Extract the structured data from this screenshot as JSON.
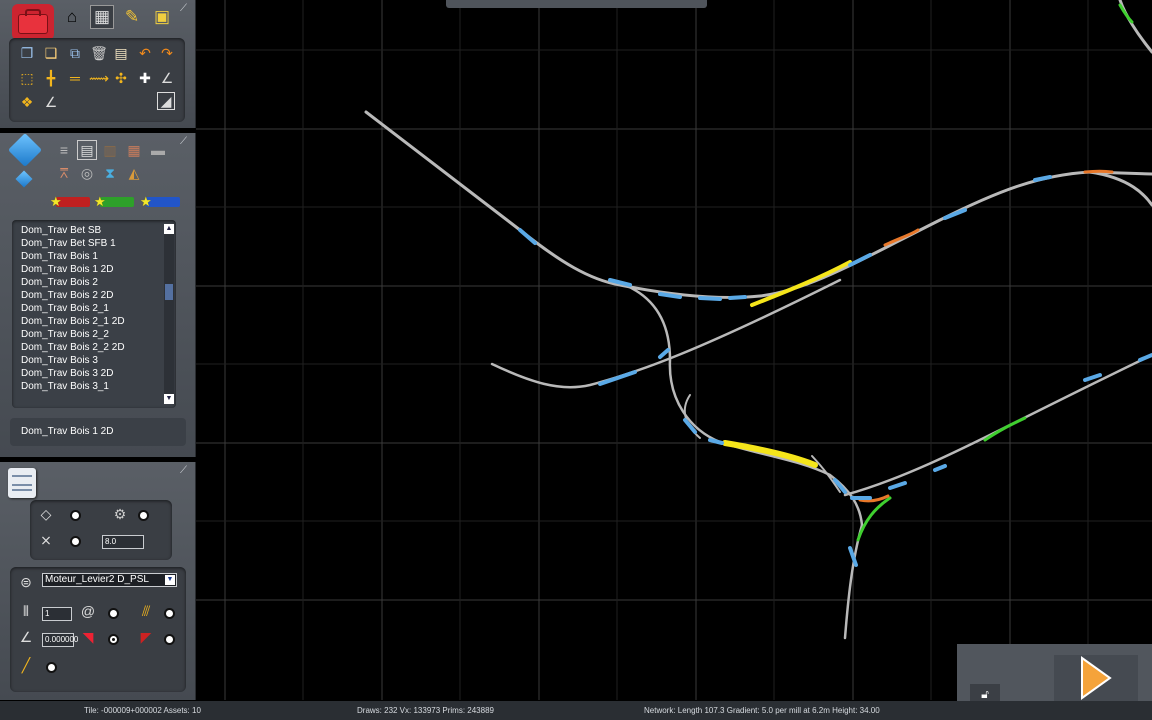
{
  "top_toolbar": {
    "icons": [
      "toolbox-icon",
      "home-icon",
      "track-grid-icon",
      "paint-brush-icon",
      "train-icon"
    ]
  },
  "tools_panel": {
    "icons": [
      "copy-icon",
      "paste-icon",
      "paste-region-icon",
      "delete-icon",
      "clone-icon",
      "undo-icon",
      "redo-icon",
      "select-region-icon",
      "join-icon",
      "split-icon",
      "track-stretch-icon",
      "fine-adjust-icon",
      "crosshair-icon",
      "angle-icon",
      "bundle-icon",
      "angle-small-icon",
      "brush-size-icon"
    ]
  },
  "asset_panel": {
    "icons": [
      "asset-cube-icon",
      "asset-cube-small-icon",
      "track-type-1-icon",
      "track-type-2-icon",
      "track-type-3-icon",
      "track-type-4-icon",
      "track-type-5-icon",
      "bridge-icon",
      "tunnel-icon",
      "junction-icon",
      "splitter-icon"
    ],
    "star_bars": [
      {
        "color": "#c02020"
      },
      {
        "color": "#2ea02a"
      },
      {
        "color": "#2255c8"
      }
    ],
    "list_items": [
      "Dom_Trav Bet SB",
      "Dom_Trav Bet SFB 1",
      "Dom_Trav Bois 1",
      "Dom_Trav Bois 1 2D",
      "Dom_Trav Bois 2",
      "Dom_Trav Bois 2 2D",
      "Dom_Trav Bois 2_1",
      "Dom_Trav Bois 2_1 2D",
      "Dom_Trav Bois 2_2",
      "Dom_Trav Bois 2_2 2D",
      "Dom_Trav Bois 3",
      "Dom_Trav Bois 3 2D",
      "Dom_Trav Bois 3_1"
    ],
    "selected": "Dom_Trav Bois 1 2D"
  },
  "properties_panel": {
    "icons": [
      "properties-notepad-icon"
    ],
    "field_height": "8.0",
    "dropdown_value": "Moteur_Levier2 D_PSL",
    "field_count": "1",
    "field_angle": "0.000000"
  },
  "status": {
    "tile": "Tile: -000009+000002  Assets: 10",
    "draws": "Draws: 232 Vx: 133973 Prims: 243889",
    "network": "Network:  Length  107.3 Gradient:  5.0 per mill at  6.2m Height:  34.00"
  },
  "colors": {
    "background": "#000000",
    "panel": "#51565d",
    "track": "#b9b9b9",
    "track_marker": "#5aa9e6",
    "highlight_yellow": "#f5e51a",
    "highlight_green": "#3fcf2f",
    "highlight_orange": "#e8782a"
  }
}
